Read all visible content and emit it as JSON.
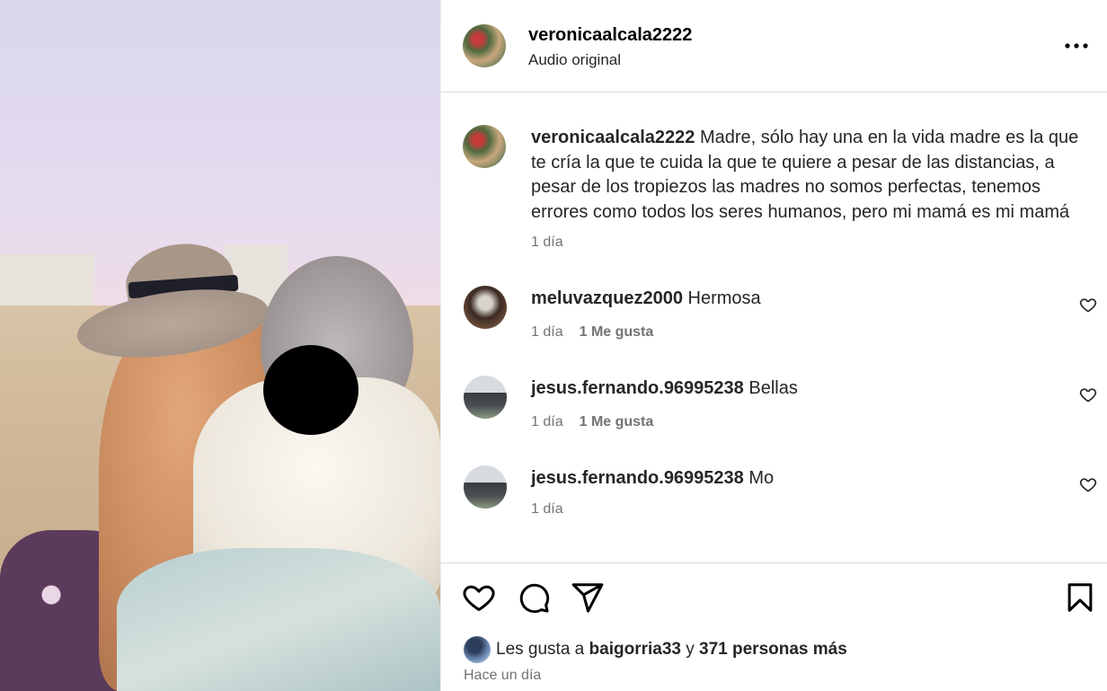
{
  "post": {
    "username": "veronicaalcala2222",
    "audio": "Audio original",
    "caption": "Madre, sólo hay una en la vida madre es la que te cría la que te cuida la que te quiere a pesar de las distancias, a pesar de los tropiezos las madres no somos perfectas, tenemos errores como todos los seres humanos, pero mi mamá es mi mamá",
    "caption_time": "1 día"
  },
  "comments": [
    {
      "username": "meluvazquez2000",
      "text": "Hermosa",
      "time": "1 día",
      "likes": "1 Me gusta"
    },
    {
      "username": "jesus.fernando.96995238",
      "text": "Bellas",
      "time": "1 día",
      "likes": "1 Me gusta"
    },
    {
      "username": "jesus.fernando.96995238",
      "text": "Mo",
      "time": "1 día",
      "likes": ""
    }
  ],
  "footer": {
    "liked_prefix": "Les gusta a",
    "liked_user": "baigorria33",
    "liked_connector": "y",
    "liked_others": "371 personas más",
    "posted_time": "Hace un día"
  },
  "icons": {
    "more": "more-options-icon",
    "like": "heart-icon",
    "comment": "comment-bubble-icon",
    "share": "send-icon",
    "save": "bookmark-icon"
  }
}
